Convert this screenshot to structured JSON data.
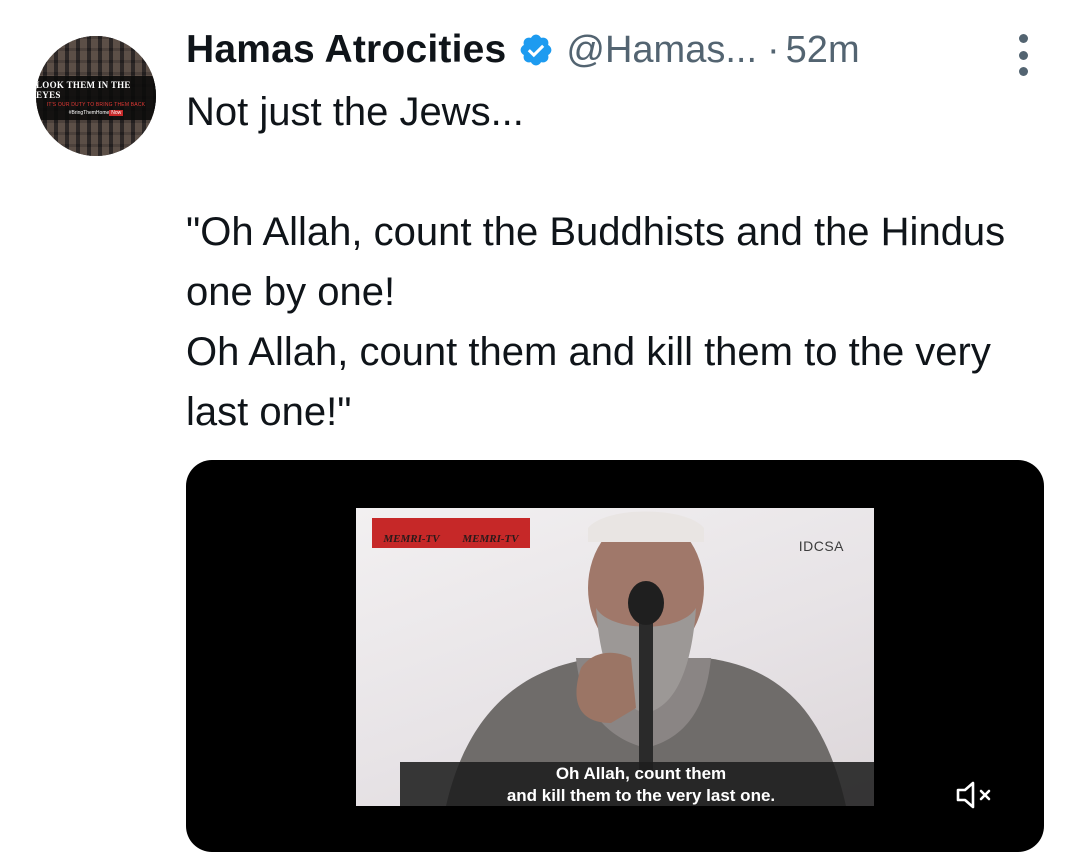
{
  "tweet": {
    "author_name": "Hamas Atrocities",
    "handle": "@Hamas...",
    "separator": "·",
    "time": "52m",
    "text": "Not just the Jews...\n\n\"Oh Allah, count the Buddhists and the Hindus one by one!\nOh Allah, count them and kill them to the very last one!\""
  },
  "avatar": {
    "line1": "LOOK THEM IN THE EYES",
    "line2": "IT'S OUR DUTY TO BRING THEM BACK",
    "line3_a": "#BringThemHome",
    "line3_b": "Now"
  },
  "video": {
    "channel_logo_1": "MEMRI-TV",
    "channel_logo_2": "MEMRI-TV",
    "watermark": "IDCSA",
    "subtitle_line1": "Oh Allah, count them",
    "subtitle_line2": "and kill them to the very last one."
  },
  "icons": {
    "verified": "verified-badge-icon",
    "more": "more-vertical-icon",
    "mute": "volume-muted-icon"
  },
  "colors": {
    "verified_blue": "#1d9bf0",
    "secondary_text": "#536471",
    "primary_text": "#0f1419",
    "memri_red": "#c62828"
  }
}
